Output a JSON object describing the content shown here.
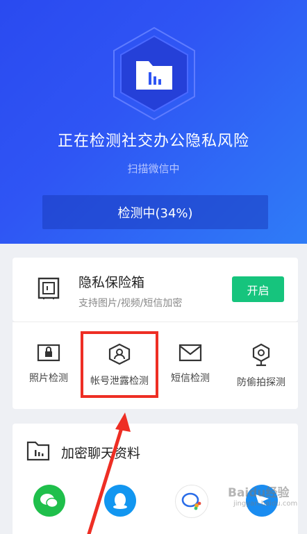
{
  "hero": {
    "title": "正在检测社交办公隐私风险",
    "subtitle": "扫描微信中",
    "progress_label": "检测中(34%)",
    "progress_value": 0.34
  },
  "vault": {
    "icon": "safe-icon",
    "title": "隐私保险箱",
    "subtitle": "支持图片/视频/短信加密",
    "button_label": "开启"
  },
  "tools": [
    {
      "label": "照片检测",
      "icon": "photo-lock-icon"
    },
    {
      "label": "帐号泄露检测",
      "icon": "account-shield-icon"
    },
    {
      "label": "短信检测",
      "icon": "envelope-icon"
    },
    {
      "label": "防偷拍探测",
      "icon": "camera-icon"
    }
  ],
  "chat_section": {
    "title": "加密聊天资料",
    "icon": "folder-chart-icon",
    "apps": [
      "wechat-icon",
      "qq-icon",
      "wecom-icon",
      "dingtalk-icon"
    ]
  },
  "watermark": {
    "text": "Baidu经验",
    "url": "jingyan.baidu.com"
  },
  "colors": {
    "hero_start": "#2a4af0",
    "hero_end": "#2f7cf7",
    "accent_green": "#16c47d",
    "highlight_red": "#ee2e24"
  }
}
